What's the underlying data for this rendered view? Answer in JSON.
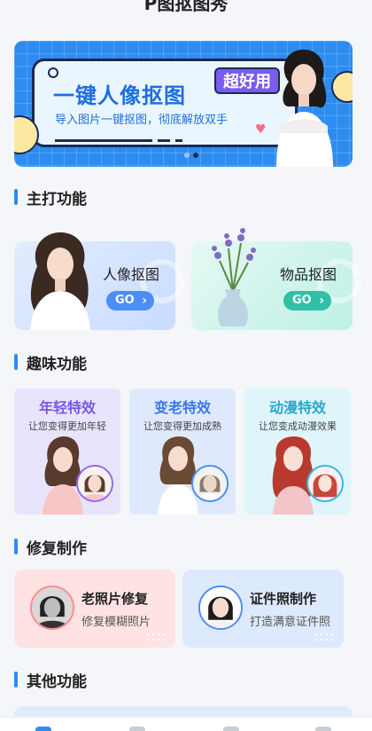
{
  "app": {
    "title": "P图抠图秀"
  },
  "banner": {
    "title": "一键人像抠图",
    "badge": "超好用",
    "subtitle": "导入图片一键抠图，彻底解放双手",
    "active_dot": 2,
    "total_dots": 2
  },
  "sections": {
    "main": "主打功能",
    "fun": "趣味功能",
    "repair": "修复制作",
    "other": "其他功能"
  },
  "main_features": [
    {
      "label": "人像抠图",
      "button": "GO"
    },
    {
      "label": "物品抠图",
      "button": "GO"
    }
  ],
  "fun_features": [
    {
      "title": "年轻特效",
      "subtitle": "让您变得更加年轻"
    },
    {
      "title": "变老特效",
      "subtitle": "让您变得更加成熟"
    },
    {
      "title": "动漫特效",
      "subtitle": "让您变成动漫效果"
    }
  ],
  "repair_features": [
    {
      "title": "老照片修复",
      "subtitle": "修复模糊照片"
    },
    {
      "title": "证件照制作",
      "subtitle": "打造满意证件照"
    }
  ],
  "colors": {
    "primary": "#2d8cf0",
    "young": "#7a57e6",
    "old": "#3a78ea",
    "anime": "#2aa7cb",
    "go_blue": "#4c8df6",
    "go_green": "#30c0a6"
  },
  "tabbar": {
    "active_index": 0,
    "icons": [
      "home-icon",
      "grid-icon",
      "tools-icon",
      "profile-icon"
    ]
  }
}
